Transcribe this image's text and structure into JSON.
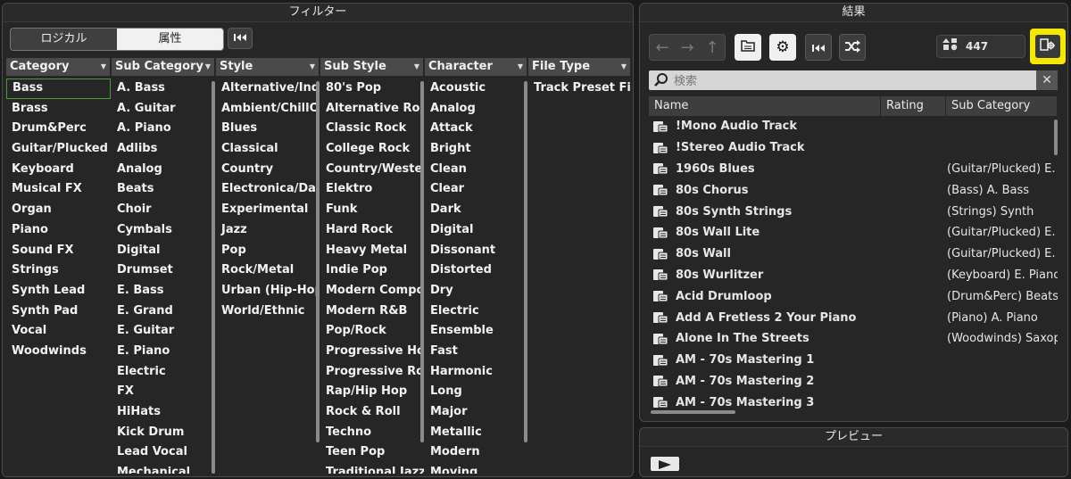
{
  "filter": {
    "title": "フィルター",
    "modes": [
      "ロジカル",
      "属性"
    ],
    "active_mode": "属性",
    "columns": [
      {
        "header": "Category",
        "items": [
          "Bass",
          "Brass",
          "Drum&Perc",
          "Guitar/Plucked",
          "Keyboard",
          "Musical FX",
          "Organ",
          "Piano",
          "Sound FX",
          "Strings",
          "Synth Lead",
          "Synth Pad",
          "Vocal",
          "Woodwinds"
        ],
        "selected": "Bass"
      },
      {
        "header": "Sub Category",
        "items": [
          "A. Bass",
          "A. Guitar",
          "A. Piano",
          "Adlibs",
          "Analog",
          "Beats",
          "Choir",
          "Cymbals",
          "Digital",
          "Drumset",
          "E. Bass",
          "E. Grand",
          "E. Guitar",
          "E. Piano",
          "Electric",
          "FX",
          "HiHats",
          "Kick Drum",
          "Lead Vocal",
          "Mechanical"
        ]
      },
      {
        "header": "Style",
        "items": [
          "Alternative/Indie",
          "Ambient/ChillOut",
          "Blues",
          "Classical",
          "Country",
          "Electronica/Dance",
          "Experimental",
          "Jazz",
          "Pop",
          "Rock/Metal",
          "Urban (Hip-Hop / R&B)",
          "World/Ethnic"
        ]
      },
      {
        "header": "Sub Style",
        "items": [
          "80's Pop",
          "Alternative Rock",
          "Classic Rock",
          "College Rock",
          "Country/Western",
          "Elektro",
          "Funk",
          "Hard Rock",
          "Heavy Metal",
          "Indie Pop",
          "Modern Composition",
          "Modern R&B",
          "Pop/Rock",
          "Progressive House",
          "Progressive Rock",
          "Rap/Hip Hop",
          "Rock & Roll",
          "Techno",
          "Teen Pop",
          "Traditional Jazz"
        ]
      },
      {
        "header": "Character",
        "items": [
          "Acoustic",
          "Analog",
          "Attack",
          "Bright",
          "Clean",
          "Clear",
          "Dark",
          "Digital",
          "Dissonant",
          "Distorted",
          "Dry",
          "Electric",
          "Ensemble",
          "Fast",
          "Harmonic",
          "Long",
          "Major",
          "Metallic",
          "Modern",
          "Moving"
        ]
      },
      {
        "header": "File Type",
        "items": [
          "Track Preset File"
        ]
      }
    ]
  },
  "results": {
    "title": "結果",
    "count": "447",
    "search_placeholder": "検索",
    "columns": [
      "Name",
      "Rating",
      "Sub Category"
    ],
    "rows": [
      {
        "name": "!Mono Audio Track",
        "sub": ""
      },
      {
        "name": "!Stereo Audio Track",
        "sub": ""
      },
      {
        "name": "1960s Blues",
        "sub": "(Guitar/Plucked) E. Guitar"
      },
      {
        "name": "80s Chorus",
        "sub": "(Bass) A. Bass"
      },
      {
        "name": "80s Synth Strings",
        "sub": "(Strings) Synth"
      },
      {
        "name": "80s Wall Lite",
        "sub": "(Guitar/Plucked) E. Guitar"
      },
      {
        "name": "80s Wall",
        "sub": "(Guitar/Plucked) E. Guitar"
      },
      {
        "name": "80s Wurlitzer",
        "sub": "(Keyboard) E. Piano"
      },
      {
        "name": "Acid Drumloop",
        "sub": "(Drum&Perc) Beats"
      },
      {
        "name": "Add A Fretless 2 Your Piano",
        "sub": "(Piano) A. Piano"
      },
      {
        "name": "Alone In The Streets",
        "sub": "(Woodwinds) Saxophone"
      },
      {
        "name": "AM - 70s Mastering 1",
        "sub": ""
      },
      {
        "name": "AM - 70s Mastering 2",
        "sub": ""
      },
      {
        "name": "AM - 70s Mastering 3",
        "sub": ""
      }
    ],
    "highlight_color": "#f5e800"
  },
  "preview": {
    "title": "プレビュー"
  }
}
